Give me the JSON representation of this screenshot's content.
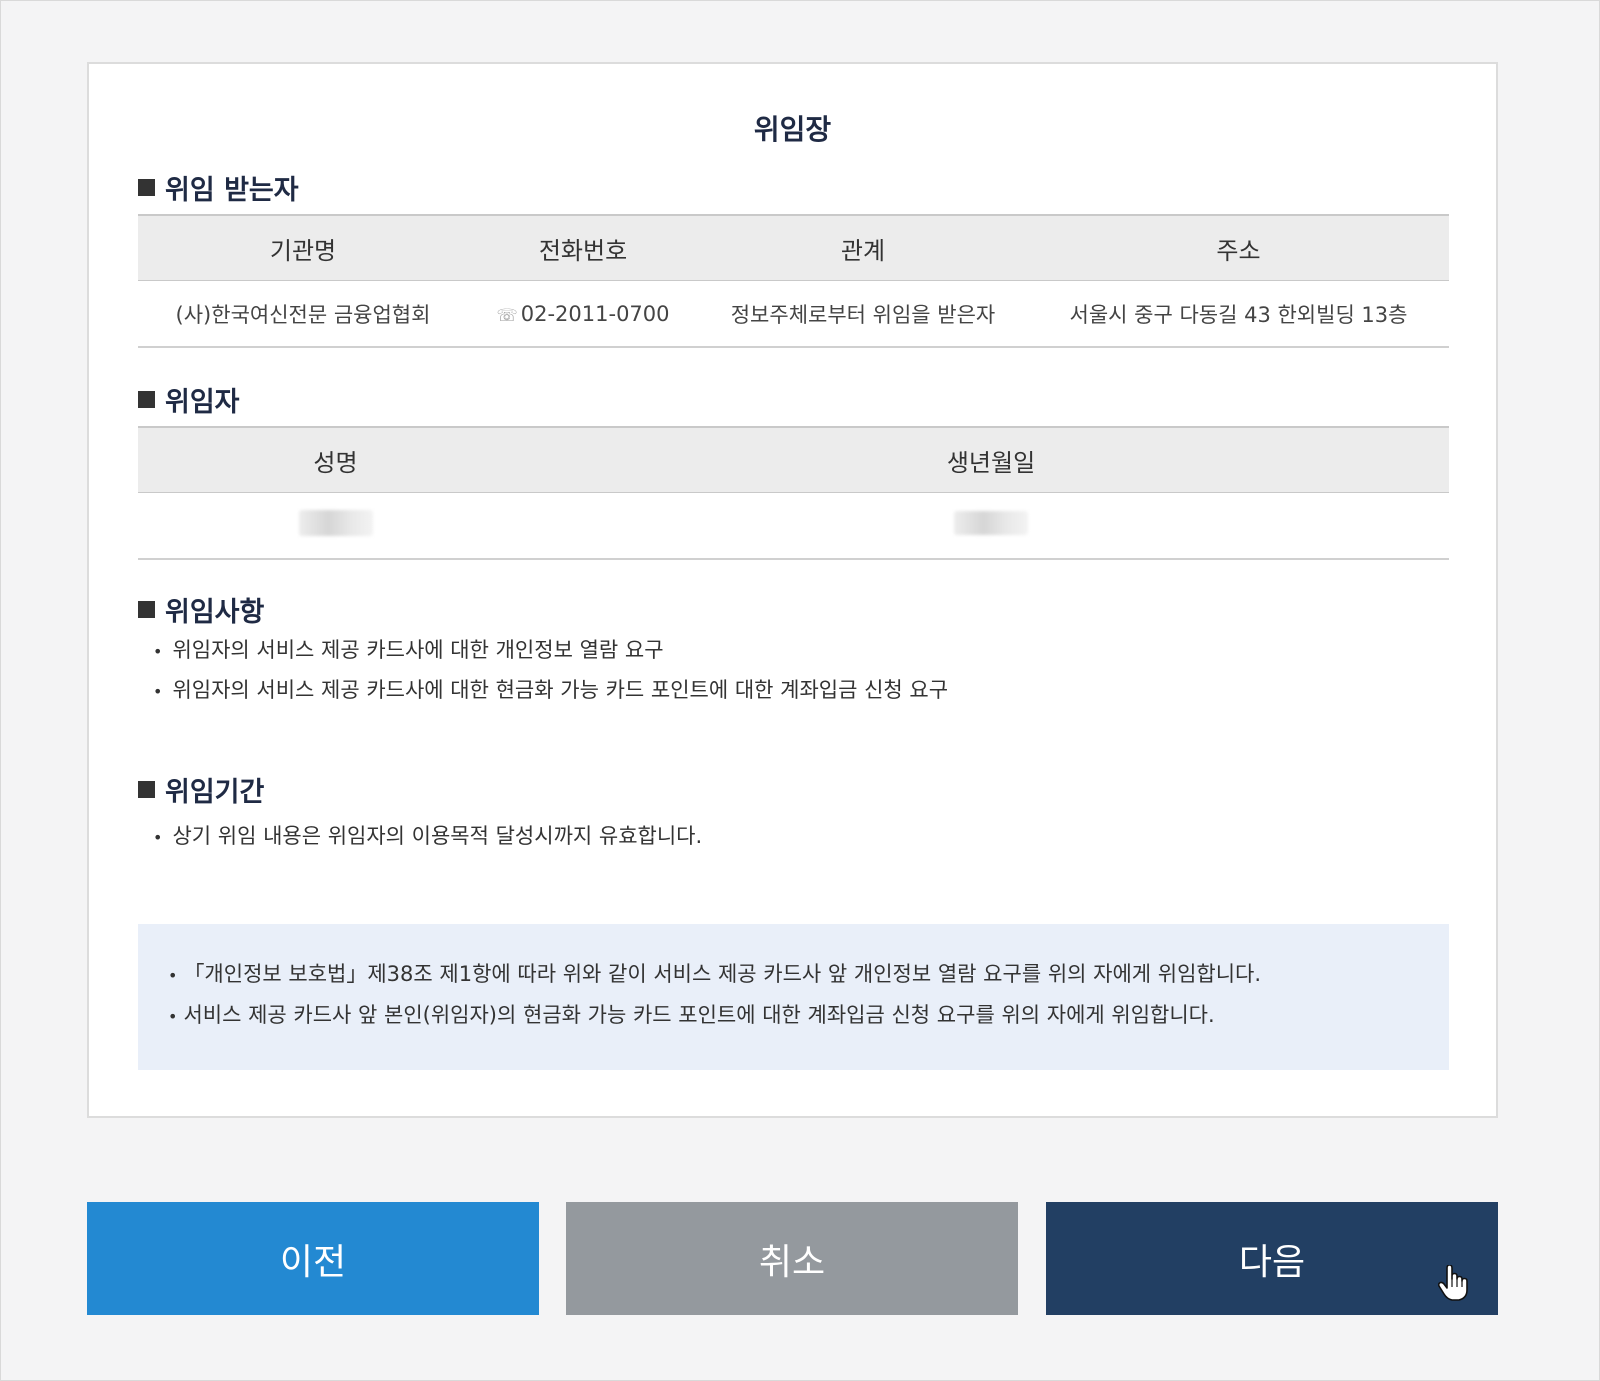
{
  "document": {
    "title": "위임장",
    "delegatee": {
      "heading": "위임 받는자",
      "columns": [
        "기관명",
        "전화번호",
        "관계",
        "주소"
      ],
      "row": {
        "org": "(사)한국여신전문 금융업협회",
        "phone_icon": "phone-icon",
        "phone": "02-2011-0700",
        "relation": "정보주체로부터 위임을 받은자",
        "address": "서울시 중구 다동길 43 한외빌딩 13층"
      }
    },
    "delegator": {
      "heading": "위임자",
      "columns": [
        "성명",
        "생년월일"
      ]
    },
    "matters": {
      "heading": "위임사항",
      "items": [
        "위임자의 서비스 제공 카드사에 대한 개인정보 열람 요구",
        "위임자의 서비스 제공 카드사에 대한 현금화 가능 카드 포인트에 대한 계좌입금 신청 요구"
      ]
    },
    "period": {
      "heading": "위임기간",
      "items": [
        "상기 위임 내용은 위임자의 이용목적 달성시까지 유효합니다."
      ]
    },
    "notice": [
      "「개인정보 보호법」제38조 제1항에 따라 위와 같이 서비스 제공 카드사 앞 개인정보 열람 요구를 위의 자에게 위임합니다.",
      "서비스 제공 카드사 앞 본인(위임자)의 현금화 가능 카드 포인트에 대한 계좌입금 신청 요구를 위의 자에게 위임합니다."
    ]
  },
  "buttons": {
    "prev": "이전",
    "cancel": "취소",
    "next": "다음"
  },
  "colors": {
    "prev": "#2389d2",
    "cancel": "#94999e",
    "next": "#223f63",
    "notice_bg": "#e9eff9"
  }
}
